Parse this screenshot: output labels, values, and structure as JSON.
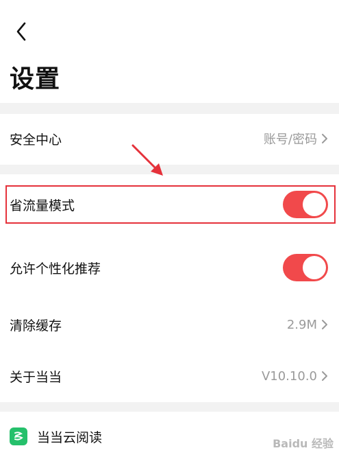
{
  "header": {
    "title": "设置"
  },
  "rows": {
    "security": {
      "label": "安全中心",
      "value": "账号/密码"
    },
    "data_saver": {
      "label": "省流量模式",
      "enabled": true
    },
    "personalized": {
      "label": "允许个性化推荐",
      "enabled": true
    },
    "clear_cache": {
      "label": "清除缓存",
      "value": "2.9M"
    },
    "about": {
      "label": "关于当当",
      "value": "V10.10.0"
    },
    "cloud_read": {
      "label": "当当云阅读"
    }
  },
  "colors": {
    "accent": "#f1494b",
    "highlight": "#e5313a",
    "app_green": "#25c06b"
  },
  "watermark": "Baidu 经验"
}
